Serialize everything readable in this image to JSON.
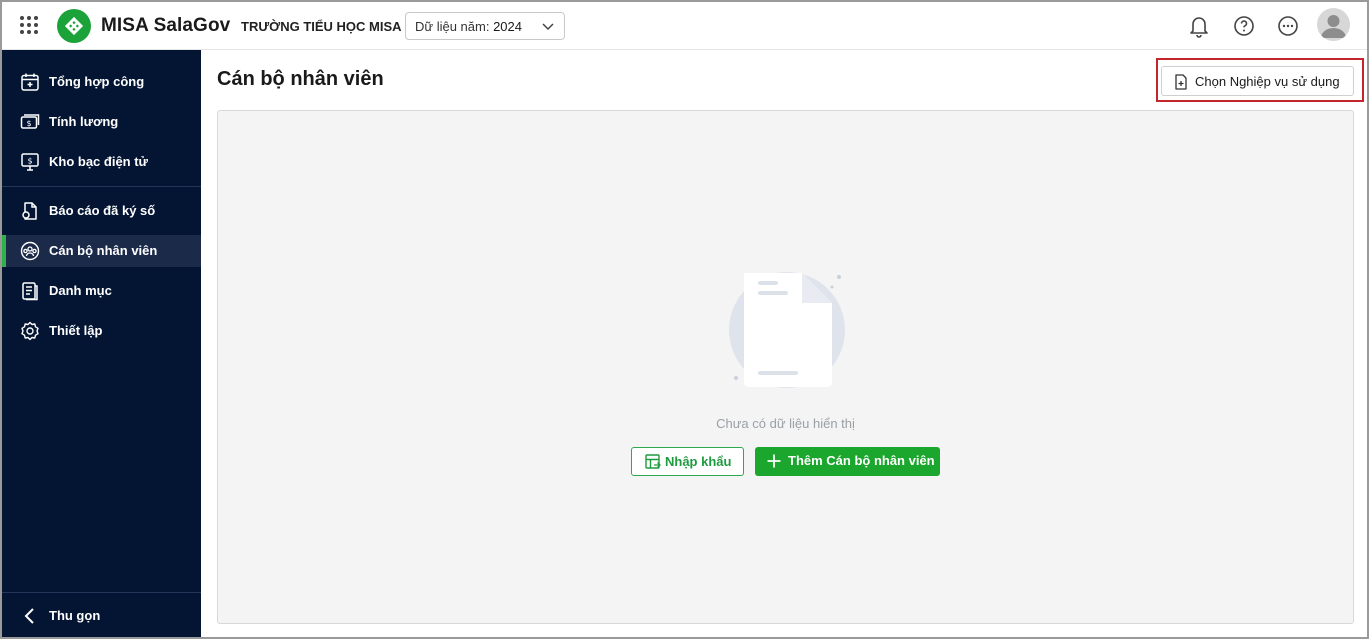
{
  "header": {
    "brand": "MISA SalaGov",
    "school": "TRƯỜNG TIỂU HỌC MISA",
    "year_label": "Dữ liệu năm:",
    "year_value": "2024"
  },
  "sidebar": {
    "items": [
      {
        "label": "Tổng hợp công",
        "icon": "calendar-plus-icon"
      },
      {
        "label": "Tính lương",
        "icon": "money-icon"
      },
      {
        "label": "Kho bạc điện tử",
        "icon": "monitor-dollar-icon"
      },
      {
        "label": "Báo cáo đã ký số",
        "icon": "signed-report-icon"
      },
      {
        "label": "Cán bộ nhân viên",
        "icon": "staff-group-icon",
        "active": true
      },
      {
        "label": "Danh mục",
        "icon": "catalog-icon"
      },
      {
        "label": "Thiết lập",
        "icon": "gear-icon"
      }
    ],
    "collapse_label": "Thu gọn"
  },
  "main": {
    "title": "Cán bộ nhân viên",
    "choose_button": "Chọn Nghiệp vụ sử dụng",
    "empty_text": "Chưa có dữ liệu hiển thị",
    "import_button": "Nhập khẩu",
    "add_button": "Thêm Cán bộ nhân viên"
  },
  "colors": {
    "sidebar_bg": "#041534",
    "accent_green": "#1ba62d",
    "highlight_red": "#c0262b"
  }
}
